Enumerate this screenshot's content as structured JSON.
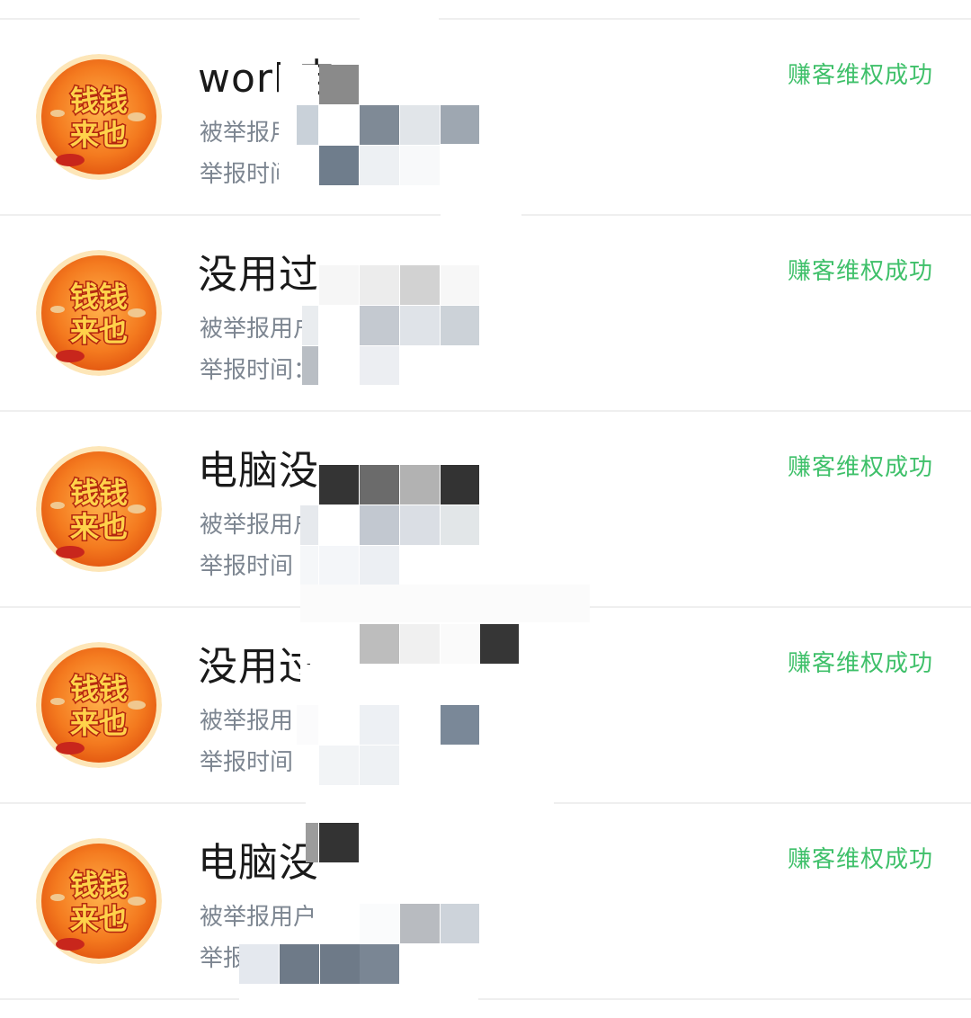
{
  "reports": [
    {
      "title": "work电",
      "reported_user": "被举报用户",
      "report_time": "举报时间",
      "status": "赚客维权成功",
      "avatar_text": [
        "钱钱",
        "来也"
      ]
    },
    {
      "title": "没用过",
      "reported_user": "被举报用户",
      "report_time": "举报时间：",
      "status": "赚客维权成功",
      "avatar_text": [
        "钱钱",
        "来也"
      ]
    },
    {
      "title": "电脑没",
      "reported_user": "被举报用户",
      "report_time": "举报时间",
      "status": "赚客维权成功",
      "avatar_text": [
        "钱钱",
        "来也"
      ]
    },
    {
      "title": "没用过",
      "reported_user": "被举报用",
      "report_time": "举报时间",
      "status": "赚客维权成功",
      "avatar_text": [
        "钱钱",
        "来也"
      ]
    },
    {
      "title": "电脑没",
      "reported_user": "被举报用户",
      "report_time": "举报",
      "status": "赚客维权成功",
      "avatar_text": [
        "钱钱",
        "来也"
      ]
    }
  ],
  "colors": {
    "status_green": "#3fc06a",
    "title": "#1a1a1a",
    "meta": "#7d8691",
    "divider": "#efefef",
    "avatar_orange": "#f47a1f",
    "avatar_text_yellow": "#ffd24a"
  }
}
